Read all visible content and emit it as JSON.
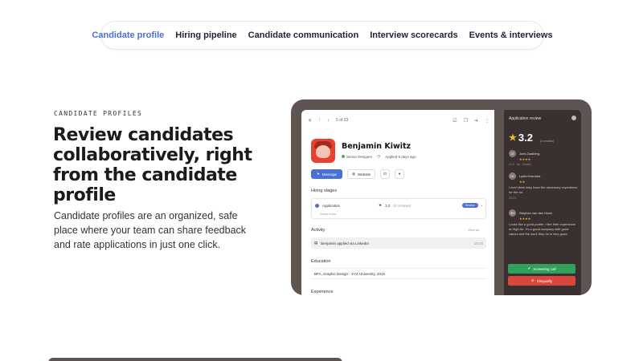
{
  "tabs": [
    {
      "label": "Candidate profile",
      "active": true
    },
    {
      "label": "Hiring pipeline",
      "active": false
    },
    {
      "label": "Candidate communication",
      "active": false
    },
    {
      "label": "Interview scorecards",
      "active": false
    },
    {
      "label": "Events & interviews",
      "active": false
    }
  ],
  "hero": {
    "eyebrow": "CANDIDATE PROFILES",
    "headline": "Review candidates collaboratively, right from the candidate profile",
    "description": "Candidate profiles are an organized, safe place where your team can share feedback and rate applications in just one click."
  },
  "profile": {
    "pager": "5 of 23",
    "name": "Benjamin Kiwitz",
    "role": "Senior Designer",
    "applied": "Applied 5 days ago",
    "message_label": "Message",
    "website_label": "Website",
    "linkedin_label": "in",
    "hiring_stages_title": "Hiring stages",
    "stage_name": "Application",
    "stage_score": "3.2",
    "stage_reviews": "(4 reviews)",
    "stage_pill": "Review",
    "show_more": "Show more",
    "activity_title": "Activity",
    "view_all": "View all",
    "activity_text": "Benjamin applied via LinkedIn",
    "activity_time": "10:34",
    "education_title": "Education",
    "education_text": "BFA, Graphic Design - XYZ University, 2015",
    "experience_title": "Experience"
  },
  "review": {
    "title": "Application review",
    "score": "3.2",
    "count": "(4 reviews)",
    "reviews": [
      {
        "initials": "JZ",
        "name": "Joris Zaalberg",
        "stars": "★★★★",
        "body": "",
        "time": "4:13 · 6d · Details"
      },
      {
        "initials": "LK",
        "name": "Lydia Kvenstra",
        "stars": "★★",
        "body": "I don't think they have the necessary experience for the rol.",
        "time": "15:13"
      },
      {
        "initials": "SH",
        "name": "Stephen van den Hoek",
        "stars": "★★★★",
        "body": "Looks like a good profile. I like their experience at High Air. It's a good company with good values and the work they do is very good.",
        "time": "15:13"
      }
    ],
    "screening_label": "Screening call",
    "disqualify_label": "Disqualify"
  },
  "colors": {
    "accent": "#4a6fd6",
    "green": "#2fa15a",
    "red": "#d9463d",
    "panel": "#3a302f",
    "frame": "#5e5452"
  }
}
